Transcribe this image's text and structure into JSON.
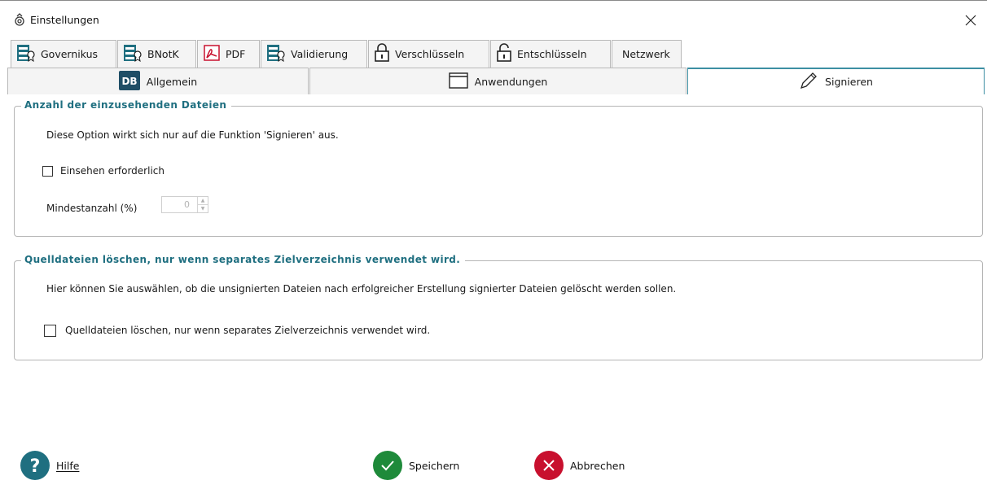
{
  "window": {
    "title": "Einstellungen"
  },
  "tabs_row1": [
    {
      "label": "Governikus",
      "icon": "server-tag-icon"
    },
    {
      "label": "BNotK",
      "icon": "server-tag-icon"
    },
    {
      "label": "PDF",
      "icon": "pdf-icon"
    },
    {
      "label": "Validierung",
      "icon": "server-tag-icon"
    },
    {
      "label": "Verschlüsseln",
      "icon": "lock-closed-icon"
    },
    {
      "label": "Entschlüsseln",
      "icon": "lock-open-icon"
    },
    {
      "label": "Netzwerk",
      "icon": ""
    }
  ],
  "tabs_row2": [
    {
      "label": "Allgemein",
      "icon": "db-icon",
      "active": false
    },
    {
      "label": "Anwendungen",
      "icon": "window-icon",
      "active": false
    },
    {
      "label": "Signieren",
      "icon": "pen-icon",
      "active": true
    }
  ],
  "group1": {
    "title": "Anzahl der einzusehenden Dateien",
    "description": "Diese Option wirkt sich nur auf die Funktion 'Signieren' aus.",
    "checkbox_label": "Einsehen erforderlich",
    "checkbox_checked": false,
    "spinner_label": "Mindestanzahl (%)",
    "spinner_value": "0",
    "spinner_enabled": false
  },
  "group2": {
    "title": "Quelldateien löschen, nur wenn separates Zielverzeichnis verwendet wird.",
    "description": "Hier können Sie auswählen, ob die unsignierten Dateien nach erfolgreicher Erstellung signierter Dateien gelöscht werden sollen.",
    "checkbox_label": "Quelldateien löschen, nur wenn separates Zielverzeichnis verwendet wird.",
    "checkbox_checked": false
  },
  "footer": {
    "help": "Hilfe",
    "save": "Speichern",
    "cancel": "Abbrechen"
  },
  "colors": {
    "accent": "#3d8fa3",
    "group_title": "#1f6f80",
    "help_blue": "#1f6f80",
    "save_green": "#1e8a3a",
    "cancel_red": "#c8102e"
  }
}
